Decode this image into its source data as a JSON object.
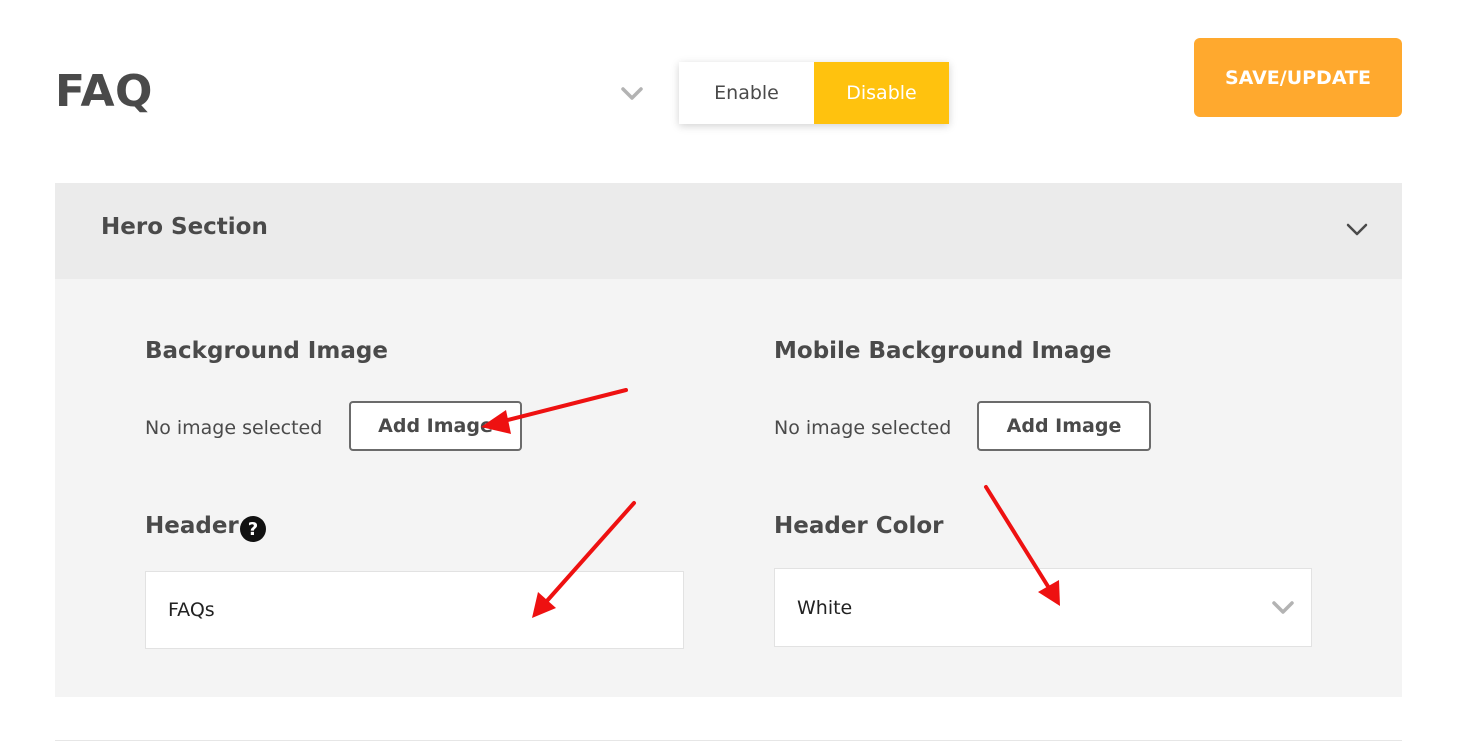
{
  "page": {
    "title": "FAQ"
  },
  "visibility_toggle": {
    "enable_label": "Enable",
    "disable_label": "Disable",
    "selected": "Disable"
  },
  "toolbar": {
    "save_label": "SAVE/UPDATE"
  },
  "hero_section": {
    "title": "Hero Section",
    "background_image": {
      "label": "Background Image",
      "status": "No image selected",
      "button_label": "Add Image"
    },
    "mobile_background_image": {
      "label": "Mobile Background Image",
      "status": "No image selected",
      "button_label": "Add Image"
    },
    "header": {
      "label": "Header",
      "help_icon": "?",
      "value": "FAQs"
    },
    "header_color": {
      "label": "Header Color",
      "value": "White"
    }
  },
  "icons": [
    "chevron-down-icon",
    "help-icon",
    "arrow-annotation"
  ],
  "colors": {
    "accent_yellow": "#ffc20e",
    "save_orange": "#ffa92e",
    "annotation_red": "#ee1111",
    "section_header_bg": "#ebebeb",
    "section_body_bg": "#f4f4f4"
  }
}
